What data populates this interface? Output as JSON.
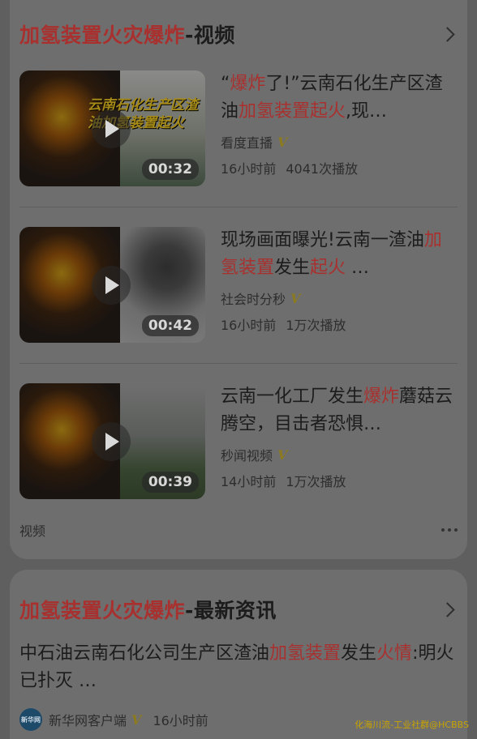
{
  "section1": {
    "title_highlight": "加氢装置火灾爆炸",
    "title_rest": "-视频",
    "footer_label": "视频"
  },
  "videos": [
    {
      "title_parts": [
        {
          "text": "“",
          "hl": false
        },
        {
          "text": "爆炸",
          "hl": true
        },
        {
          "text": "了!”云南石化生产区渣油",
          "hl": false
        },
        {
          "text": "加氢装置起火",
          "hl": true
        },
        {
          "text": ",现…",
          "hl": false
        }
      ],
      "overlay_text": "云南石化生产区渣油加氢装置起火",
      "duration": "00:32",
      "source": "看度直播",
      "time": "16小时前",
      "plays": "4041次播放"
    },
    {
      "title_parts": [
        {
          "text": "现场画面曝光!云南一渣油",
          "hl": false
        },
        {
          "text": "加氢装置",
          "hl": true
        },
        {
          "text": "发生",
          "hl": false
        },
        {
          "text": "起火",
          "hl": true
        },
        {
          "text": " …",
          "hl": false
        }
      ],
      "overlay_text": "",
      "duration": "00:42",
      "source": "社会时分秒",
      "time": "16小时前",
      "plays": "1万次播放"
    },
    {
      "title_parts": [
        {
          "text": "云南一化工厂发生",
          "hl": false
        },
        {
          "text": "爆炸",
          "hl": true
        },
        {
          "text": "蘑菇云腾空，目击者恐惧…",
          "hl": false
        }
      ],
      "overlay_text": "",
      "duration": "00:39",
      "source": "秒闻视频",
      "time": "14小时前",
      "plays": "1万次播放"
    }
  ],
  "verified_mark": "V",
  "section2": {
    "title_highlight": "加氢装置火灾爆炸",
    "title_rest": "-最新资讯",
    "news_parts": [
      {
        "text": "中石油云南石化公司生产区渣油",
        "hl": false
      },
      {
        "text": "加氢装置",
        "hl": true
      },
      {
        "text": "发生",
        "hl": false
      },
      {
        "text": "火情",
        "hl": true
      },
      {
        "text": ":明火已扑灭 …",
        "hl": false
      }
    ],
    "logo_text": "新华网",
    "source": "新华网客户端",
    "time": "16小时前"
  },
  "watermark": "化海川流-工业社群@HCBBS",
  "colors": {
    "highlight": "#a8312f",
    "verified": "#8c7a20",
    "background": "#5f5f5f",
    "card": "#6e6e6e"
  }
}
